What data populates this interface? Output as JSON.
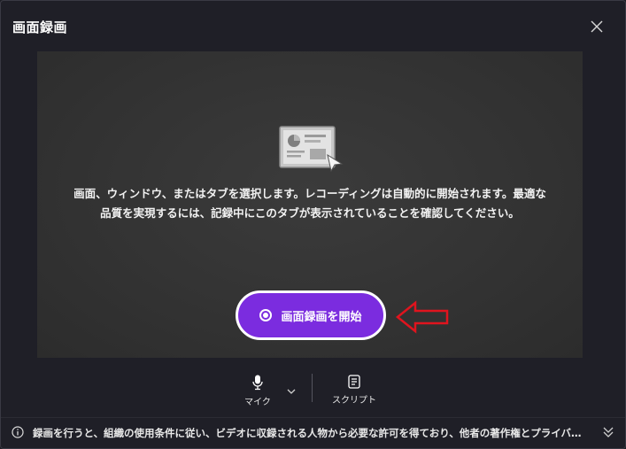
{
  "dialog": {
    "title": "画面録画",
    "close_icon": "close-icon"
  },
  "preview": {
    "illustration_icon": "screen-share-illustration-icon",
    "instruction": "画面、ウィンドウ、またはタブを選択します。レコーディングは自動的に開始されます。最適な品質を実現するには、記録中にこのタブが表示されていることを確認してください。",
    "start_button_label": "画面録画を開始",
    "accent_color": "#7b2cdf",
    "annotation_arrow_color": "#e0141e"
  },
  "toolbar": {
    "mic_label": "マイク",
    "script_label": "スクリプト"
  },
  "footer": {
    "notice": "録画を行うと、組織の使用条件に従い、ビデオに収録される人物から必要な許可を得ており、他者の著作権とプライバシーを尊重することに同意したものとみなされます。"
  }
}
